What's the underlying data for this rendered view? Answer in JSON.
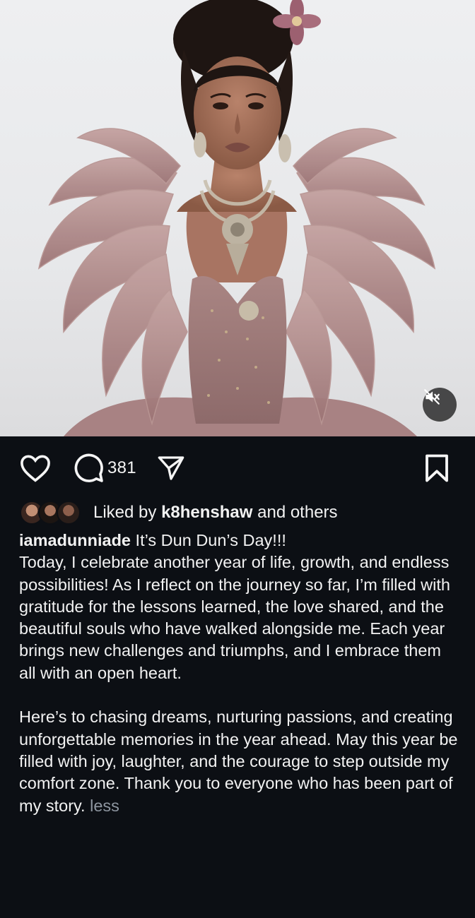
{
  "post": {
    "media": {
      "type": "video",
      "subject": "portrait",
      "muted": true,
      "mute_icon": "speaker-muted-icon"
    },
    "actions": {
      "like_icon": "heart-outline-icon",
      "comment_icon": "comment-bubble-icon",
      "comment_count": "381",
      "share_icon": "paper-plane-icon",
      "save_icon": "bookmark-outline-icon"
    },
    "likes": {
      "prefix": "Liked by ",
      "user": "k8henshaw",
      "suffix": " and others"
    },
    "caption": {
      "username": "iamadunniade",
      "first_line": " It’s Dun Dun’s Day!!!",
      "paragraph_1": "Today, I celebrate another year of life, growth, and endless possibilities! As I reflect on the journey so far, I’m filled with gratitude for the lessons learned, the love shared, and the beautiful souls who have walked alongside me. Each year brings new challenges and triumphs, and I embrace them all with an open heart.",
      "paragraph_2": "Here’s to chasing dreams, nurturing passions, and creating unforgettable memories in the year ahead. May this year be filled with joy, laughter, and the courage to step outside my comfort zone. Thank you to everyone who has been part of my story.",
      "less_label": "less"
    }
  },
  "colors": {
    "background": "#0c0f14",
    "text": "#f2f2f2",
    "muted_text": "#8e96a0",
    "gown": "#a47f80",
    "mute_button": "#262626"
  }
}
